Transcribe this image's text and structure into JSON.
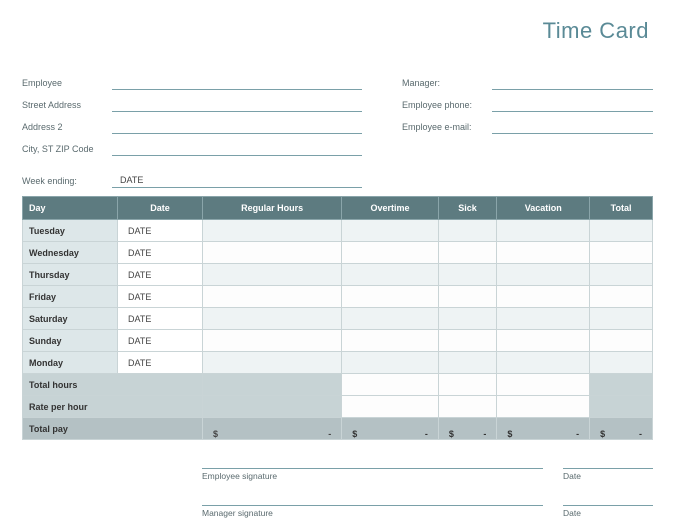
{
  "title": "Time Card",
  "fields": {
    "employee": "Employee",
    "street": "Street Address",
    "address2": "Address 2",
    "city": "City, ST  ZIP Code",
    "manager": "Manager:",
    "phone": "Employee phone:",
    "email": "Employee e-mail:"
  },
  "week_ending_label": "Week ending:",
  "week_ending_value": "DATE",
  "table": {
    "headers": [
      "Day",
      "Date",
      "Regular Hours",
      "Overtime",
      "Sick",
      "Vacation",
      "Total"
    ],
    "rows": [
      {
        "day": "Tuesday",
        "date": "DATE"
      },
      {
        "day": "Wednesday",
        "date": "DATE"
      },
      {
        "day": "Thursday",
        "date": "DATE"
      },
      {
        "day": "Friday",
        "date": "DATE"
      },
      {
        "day": "Saturday",
        "date": "DATE"
      },
      {
        "day": "Sunday",
        "date": "DATE"
      },
      {
        "day": "Monday",
        "date": "DATE"
      }
    ],
    "summary": {
      "total_hours": "Total hours",
      "rate": "Rate per hour",
      "total_pay": "Total pay"
    },
    "pay_symbol": "$",
    "pay_dash": "-"
  },
  "signatures": {
    "employee": "Employee signature",
    "manager": "Manager signature",
    "date": "Date"
  }
}
